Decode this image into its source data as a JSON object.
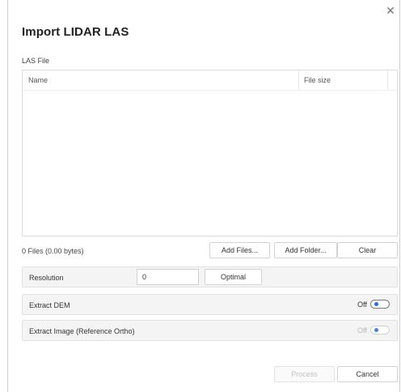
{
  "dialog": {
    "title": "Import LIDAR LAS",
    "close_icon": "close-icon"
  },
  "las_file": {
    "section_label": "LAS File",
    "columns": {
      "name": "Name",
      "size": "File size"
    },
    "rows": [],
    "files_count": "0 Files (0.00 bytes)",
    "buttons": {
      "add_files": "Add Files...",
      "add_folder": "Add Folder...",
      "clear": "Clear"
    }
  },
  "resolution": {
    "label": "Resolution",
    "value": "0",
    "optimal_label": "Optimal"
  },
  "extract_dem": {
    "label": "Extract DEM",
    "state_label": "Off",
    "enabled": true
  },
  "extract_image": {
    "label": "Extract Image (Reference Ortho)",
    "state_label": "Off",
    "enabled": false
  },
  "footer": {
    "process_label": "Process",
    "cancel_label": "Cancel"
  },
  "colors": {
    "accent": "#1a73e8",
    "row_background": "#f4f4f4",
    "border": "#d3d3d3"
  }
}
